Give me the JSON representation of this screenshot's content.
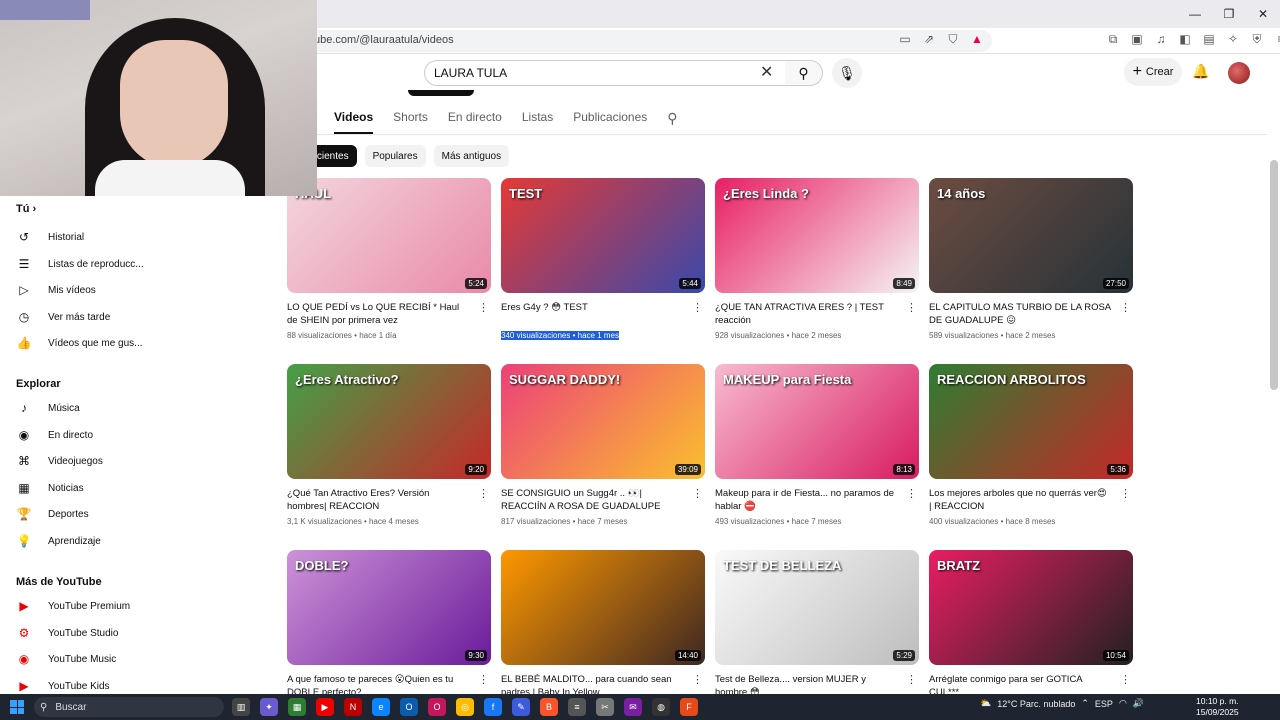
{
  "browser": {
    "url": "ube.com/@lauraatula/videos",
    "window_controls": [
      "—",
      "❐",
      "✕"
    ]
  },
  "header": {
    "search_value": "LAURA TULA",
    "create_label": "Crear"
  },
  "channel_tabs": [
    "Videos",
    "Shorts",
    "En directo",
    "Listas",
    "Publicaciones"
  ],
  "chips": [
    "recientes",
    "Populares",
    "Más antiguos"
  ],
  "sidebar": {
    "you_label": "Tú",
    "you_items": [
      "Historial",
      "Listas de reproducc...",
      "Mis vídeos",
      "Ver más tarde",
      "Vídeos que me gus..."
    ],
    "explore_label": "Explorar",
    "explore_items": [
      "Música",
      "En directo",
      "Videojuegos",
      "Noticias",
      "Deportes",
      "Aprendizaje"
    ],
    "more_label": "Más de YouTube",
    "more_items": [
      "YouTube Premium",
      "YouTube Studio",
      "YouTube Music",
      "YouTube Kids"
    ]
  },
  "videos": [
    {
      "title": "LO QUE PEDÍ vs Lo QUE RECIBÍ * Haul de SHEIN por primera vez",
      "views": "88 visualizaciones",
      "age": "hace 1 día",
      "duration": "5:24",
      "thumb_text": "HAUL",
      "colors": [
        "#f3d6dd",
        "#e98aa8"
      ]
    },
    {
      "title": "Eres G4y ? 😳 TEST",
      "views": "340 visualizaciones",
      "age": "hace 1 mes",
      "duration": "5:44",
      "thumb_text": "TEST",
      "colors": [
        "#e53935",
        "#3949ab"
      ]
    },
    {
      "title": "¿QUE TAN ATRACTIVA ERES ? | TEST reacción",
      "views": "928 visualizaciones",
      "age": "hace 2 meses",
      "duration": "8:49",
      "thumb_text": "¿Eres Linda ?",
      "colors": [
        "#e91e63",
        "#f5f5f5"
      ]
    },
    {
      "title": "EL CAPITULO MAS TURBIO DE LA ROSA DE GUADALUPE 😖",
      "views": "589 visualizaciones",
      "age": "hace 2 meses",
      "duration": "27:50",
      "thumb_text": "14 años",
      "colors": [
        "#6d4c41",
        "#263238"
      ]
    },
    {
      "title": "¿Qué Tan Atractivo Eres? Versión hombres| REACCION",
      "views": "3,1 K visualizaciones",
      "age": "hace 4 meses",
      "duration": "9:20",
      "thumb_text": "¿Eres Atractivo?",
      "colors": [
        "#43a047",
        "#c62828"
      ]
    },
    {
      "title": "SE CONSIGUIO un Sugg4r .. 👀| REACCIÍN A ROSA DE GUADALUPE",
      "views": "817 visualizaciones",
      "age": "hace 7 meses",
      "duration": "39:09",
      "thumb_text": "SUGGAR DADDY!",
      "colors": [
        "#ec407a",
        "#fbc02d"
      ]
    },
    {
      "title": "Makeup para ir de Fiesta... no paramos de hablar ⛔",
      "views": "493 visualizaciones",
      "age": "hace 7 meses",
      "duration": "8:13",
      "thumb_text": "MAKEUP para Fiesta",
      "colors": [
        "#f8bbd0",
        "#d81b60"
      ]
    },
    {
      "title": "Los mejores arboles que no querrás ver😍 | REACCION",
      "views": "400 visualizaciones",
      "age": "hace 8 meses",
      "duration": "5:36",
      "thumb_text": "REACCION ARBOLITOS",
      "colors": [
        "#2e7d32",
        "#c62828"
      ]
    },
    {
      "title": "A que famoso te pareces 😮Quien es tu DOBLE perfecto?",
      "views": "",
      "age": "",
      "duration": "9:30",
      "thumb_text": "DOBLE?",
      "colors": [
        "#ce93d8",
        "#6a1b9a"
      ]
    },
    {
      "title": "EL BEBÉ MALDITO... para cuando sean padres | Baby In Yellow",
      "views": "",
      "age": "",
      "duration": "14:40",
      "thumb_text": "",
      "colors": [
        "#ff9800",
        "#3e2723"
      ]
    },
    {
      "title": "Test de Belleza.... version MUJER y hombre 😳",
      "views": "",
      "age": "",
      "duration": "5:29",
      "thumb_text": "TEST DE BELLEZA",
      "colors": [
        "#fafafa",
        "#bdbdbd"
      ]
    },
    {
      "title": "Arréglate conmigo para ser GOTICA CUL***",
      "views": "",
      "age": "",
      "duration": "10:54",
      "thumb_text": "BRATZ",
      "colors": [
        "#e91e63",
        "#212121"
      ]
    }
  ],
  "taskbar": {
    "search_label": "Buscar",
    "weather": "12°C  Parc. nublado",
    "lang": "ESP",
    "time": "10:10 p. m.",
    "date": "15/09/2025"
  }
}
